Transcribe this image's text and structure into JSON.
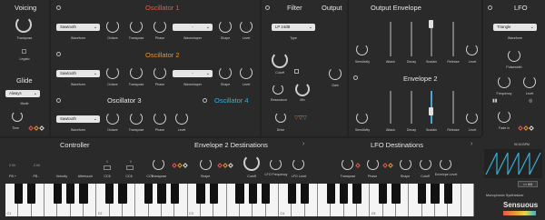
{
  "voicing": {
    "title": "Voicing",
    "transpose_label": "Transpose",
    "legato_label": "Legato"
  },
  "glide": {
    "title": "Glide",
    "mode_value": "Always",
    "mode_label": "Mode",
    "time_label": "Time"
  },
  "osc1": {
    "title": "Oscillator 1",
    "waveform": "Sawtooth",
    "waveform_label": "Waveform",
    "octave_label": "Octave",
    "transpose_label": "Transpose",
    "phase_label": "Phase",
    "waveshaper": "-",
    "waveshaper_label": "Waveshaper",
    "shape_label": "Shape",
    "level_label": "Level"
  },
  "osc2": {
    "title": "Oscillator 2",
    "waveform": "Sawtooth",
    "waveform_label": "Waveform",
    "octave_label": "Octave",
    "transpose_label": "Transpose",
    "phase_label": "Phase",
    "waveshaper": "-",
    "waveshaper_label": "Waveshaper",
    "shape_label": "Shape",
    "level_label": "Level"
  },
  "osc3": {
    "title": "Oscillator 3",
    "waveform": "Sawtooth",
    "waveform_label": "Waveform",
    "octave_label": "Octave",
    "transpose_label": "Transpose",
    "phase_label": "Phase",
    "level_label": "Level"
  },
  "osc4": {
    "title": "Oscillator 4"
  },
  "filter": {
    "title": "Filter",
    "type": "LP 24dB",
    "type_label": "Type",
    "cutoff_label": "Cutoff",
    "resonance_label": "Resonance",
    "mix_label": "Mix",
    "drive_label": "Drive"
  },
  "output": {
    "title": "Output",
    "gain_label": "Gain"
  },
  "output_envelope": {
    "title": "Output Envelope",
    "labels": [
      "Sensitivity",
      "Attack",
      "Decay",
      "Sustain",
      "Release",
      "Level"
    ]
  },
  "envelope2": {
    "title": "Envelope 2",
    "labels": [
      "Sensitivity",
      "Attack",
      "Decay",
      "Sustain",
      "Release",
      "Level"
    ]
  },
  "lfo": {
    "title": "LFO",
    "waveform": "Triangle",
    "waveform_label": "Waveform",
    "pulsewidth_label": "Pulsewidth",
    "frequency_label": "Frequency",
    "level_label": "Level",
    "fadein_label": "Fade in",
    "bpm": "90.00 BPM",
    "sync_label": ">> 8/8"
  },
  "controller": {
    "title": "Controller",
    "labels": [
      "PB +",
      "PB -",
      "Velocity",
      "Aftertouch",
      "CC6",
      "CC6",
      "CC6"
    ],
    "values": [
      "2.00",
      "-2.00",
      "",
      "",
      "0",
      "0",
      "0"
    ]
  },
  "env2_dest": {
    "title": "Envelope 2 Destinations",
    "labels": [
      "Transpose",
      "Shape",
      "Cutoff",
      "LFO Frequency",
      "LFO Level"
    ]
  },
  "lfo_dest": {
    "title": "LFO Destinations",
    "labels": [
      "Transpose",
      "Phase",
      "Shape",
      "Cutoff",
      "Envelope Level"
    ]
  },
  "keyboard": {
    "octaves": [
      "C1",
      "C2",
      "C3",
      "C4",
      "C5"
    ]
  },
  "brand": {
    "subtitle": "Monophonic Synthesizer",
    "name": "Sensuous"
  }
}
